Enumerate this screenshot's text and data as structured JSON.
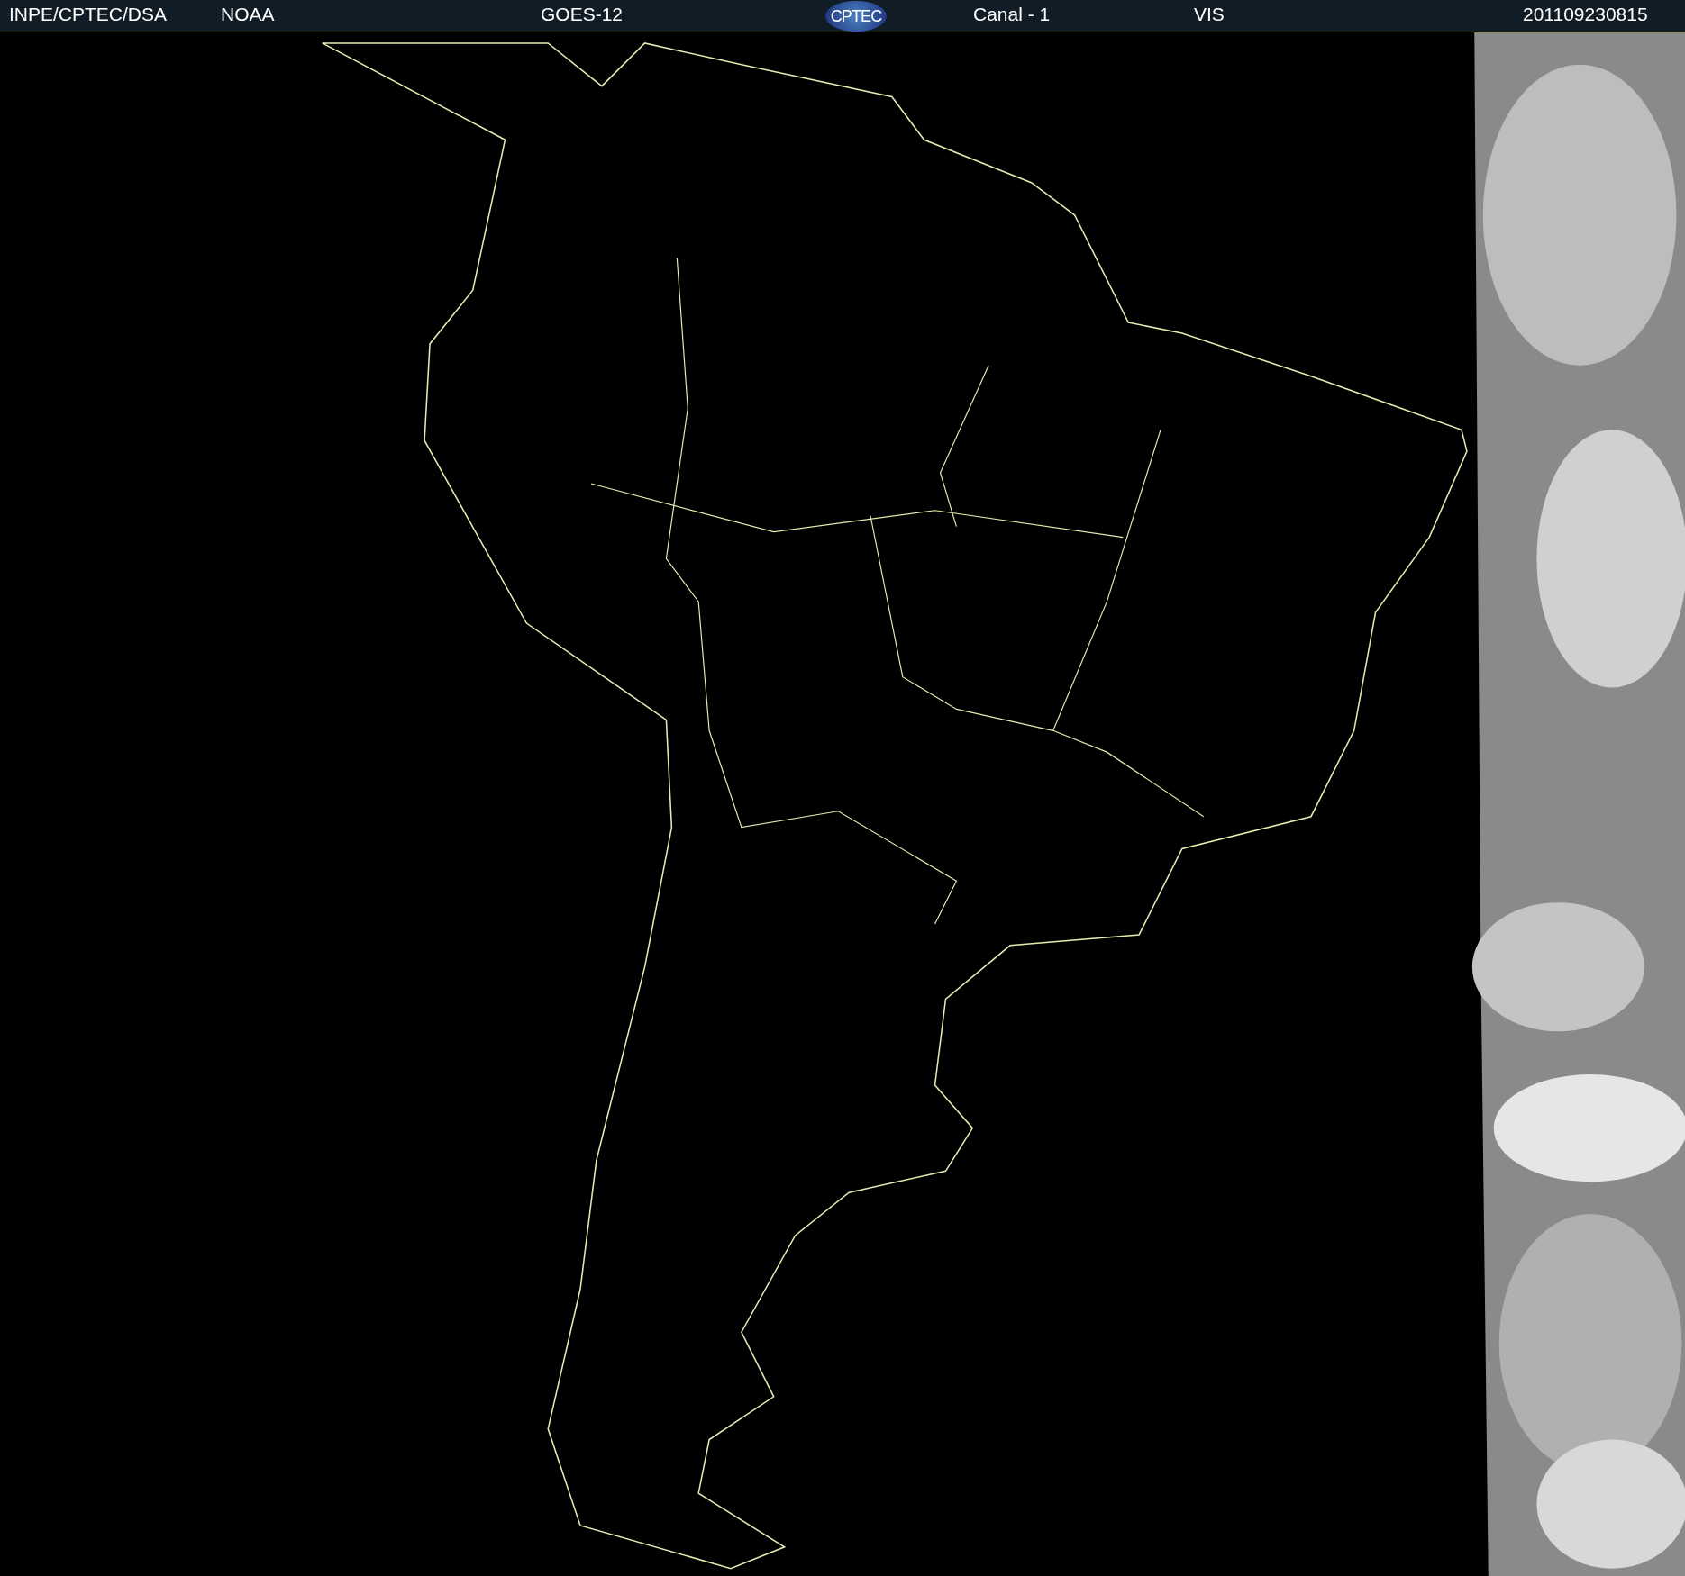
{
  "header": {
    "items": [
      {
        "kind": "text",
        "text": "INPE/CPTEC/DSA"
      },
      {
        "kind": "text",
        "text": "NOAA"
      },
      {
        "kind": "text",
        "text": "GOES-12"
      },
      {
        "kind": "logo",
        "text": "CPTEC"
      },
      {
        "kind": "text",
        "text": "Canal - 1"
      },
      {
        "kind": "text",
        "text": "VIS"
      },
      {
        "kind": "text",
        "text": "201109230815"
      }
    ]
  }
}
